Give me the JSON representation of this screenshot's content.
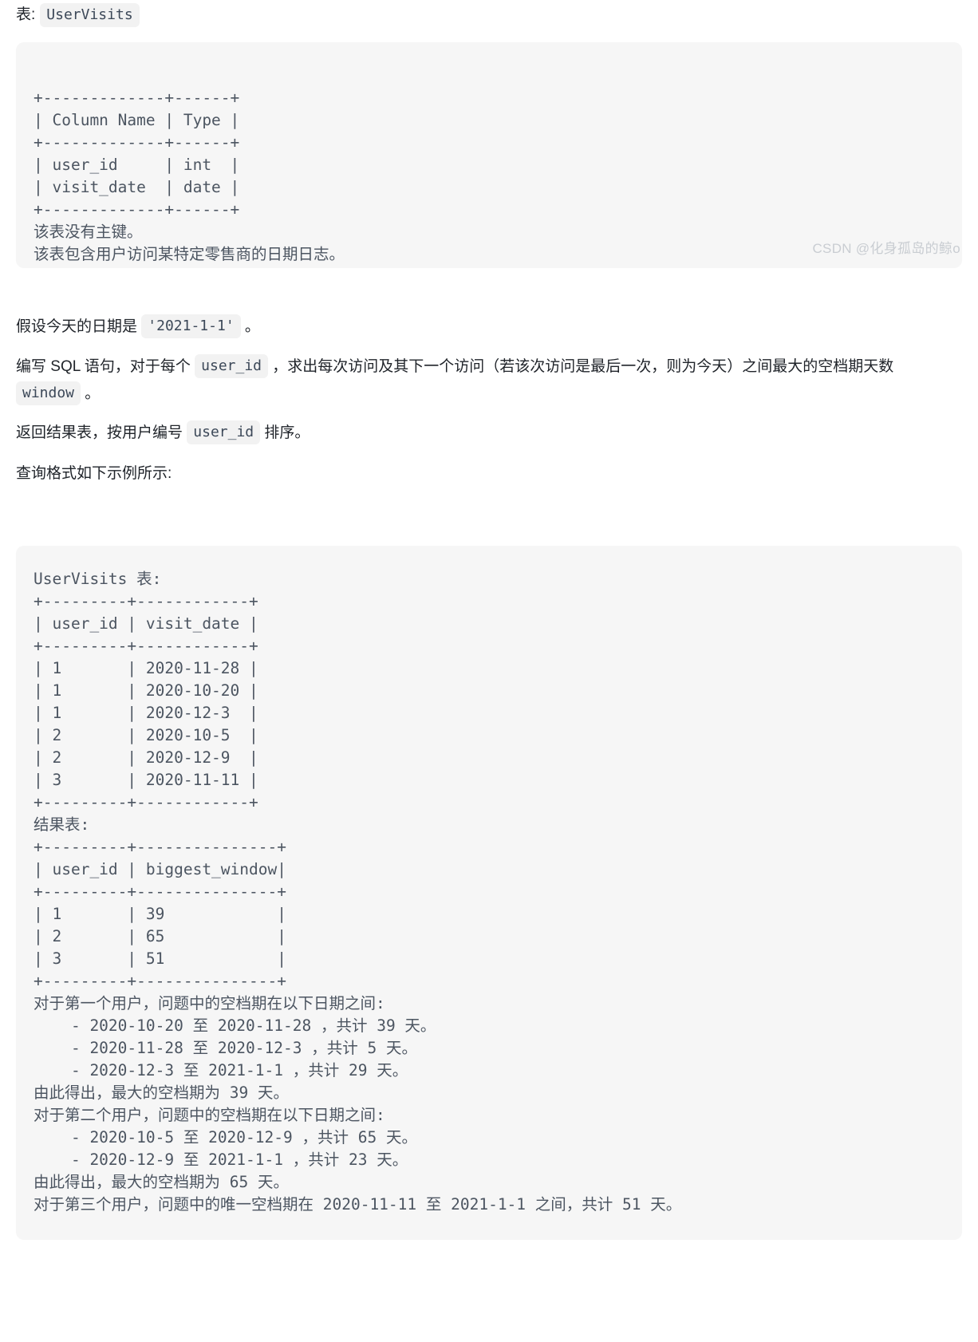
{
  "document": {
    "type": "leetcode-problem-statement",
    "language": "zh-CN"
  },
  "table_intro": {
    "label": "表:",
    "table_name": "UserVisits"
  },
  "schema_block": {
    "lines": [
      "+-------------+------+",
      "| Column Name | Type |",
      "+-------------+------+",
      "| user_id     | int  |",
      "| visit_date  | date |",
      "+-------------+------+",
      "该表没有主键。",
      "该表包含用户访问某特定零售商的日期日志。"
    ],
    "text": "+-------------+------+\n| Column Name | Type |\n+-------------+------+\n| user_id     | int  |\n| visit_date  | date |\n+-------------+------+\n该表没有主键。\n该表包含用户访问某特定零售商的日期日志。"
  },
  "paragraphs": {
    "today": {
      "prefix": "假设今天的日期是 ",
      "code": "'2021-1-1'",
      "suffix": " 。"
    },
    "write_sql": {
      "part1": "编写 SQL 语句，对于每个 ",
      "code1": "user_id",
      "part2": " ，求出每次访问及其下一个访问（若该次访问是最后一次，则为今天）之间最大的空档期天数 ",
      "code2": "window",
      "part3": " 。"
    },
    "return_result": {
      "part1": "返回结果表，按用户编号 ",
      "code1": "user_id",
      "part2": " 排序。"
    },
    "format_note": "查询格式如下示例所示:"
  },
  "example_block": {
    "text": "UserVisits 表:\n+---------+------------+\n| user_id | visit_date |\n+---------+------------+\n| 1       | 2020-11-28 |\n| 1       | 2020-10-20 |\n| 1       | 2020-12-3  |\n| 2       | 2020-10-5  |\n| 2       | 2020-12-9  |\n| 3       | 2020-11-11 |\n+---------+------------+\n结果表:\n+---------+---------------+\n| user_id | biggest_window|\n+---------+---------------+\n| 1       | 39            |\n| 2       | 65            |\n| 3       | 51            |\n+---------+---------------+\n对于第一个用户，问题中的空档期在以下日期之间:\n    - 2020-10-20 至 2020-11-28 ，共计 39 天。\n    - 2020-11-28 至 2020-12-3 ，共计 5 天。\n    - 2020-12-3 至 2021-1-1 ，共计 29 天。\n由此得出，最大的空档期为 39 天。\n对于第二个用户，问题中的空档期在以下日期之间:\n    - 2020-10-5 至 2020-12-9 ，共计 65 天。\n    - 2020-12-9 至 2021-1-1 ，共计 23 天。\n由此得出，最大的空档期为 65 天。\n对于第三个用户，问题中的唯一空档期在 2020-11-11 至 2021-1-1 之间，共计 51 天。",
    "input_table": {
      "title": "UserVisits 表:",
      "columns": [
        "user_id",
        "visit_date"
      ],
      "rows": [
        [
          "1",
          "2020-11-28"
        ],
        [
          "1",
          "2020-10-20"
        ],
        [
          "1",
          "2020-12-3"
        ],
        [
          "2",
          "2020-10-5"
        ],
        [
          "2",
          "2020-12-9"
        ],
        [
          "3",
          "2020-11-11"
        ]
      ]
    },
    "output_table": {
      "title": "结果表:",
      "columns": [
        "user_id",
        "biggest_window"
      ],
      "rows": [
        [
          "1",
          "39"
        ],
        [
          "2",
          "65"
        ],
        [
          "3",
          "51"
        ]
      ]
    },
    "explanation": [
      "对于第一个用户，问题中的空档期在以下日期之间:",
      "    - 2020-10-20 至 2020-11-28 ，共计 39 天。",
      "    - 2020-11-28 至 2020-12-3 ，共计 5 天。",
      "    - 2020-12-3 至 2021-1-1 ，共计 29 天。",
      "由此得出，最大的空档期为 39 天。",
      "对于第二个用户，问题中的空档期在以下日期之间:",
      "    - 2020-10-5 至 2020-12-9 ，共计 65 天。",
      "    - 2020-12-9 至 2021-1-1 ，共计 23 天。",
      "由此得出，最大的空档期为 65 天。",
      "对于第三个用户，问题中的唯一空档期在 2020-11-11 至 2021-1-1 之间，共计 51 天。"
    ]
  },
  "watermark": {
    "text": "CSDN @化身孤岛的鲸o"
  },
  "colors": {
    "page_background": "#ffffff",
    "code_background": "#f6f6f6",
    "chip_background": "#f2f2f2",
    "body_text": "#1f2329",
    "code_text": "#4c5561",
    "watermark_text": "#c9cdd2"
  }
}
